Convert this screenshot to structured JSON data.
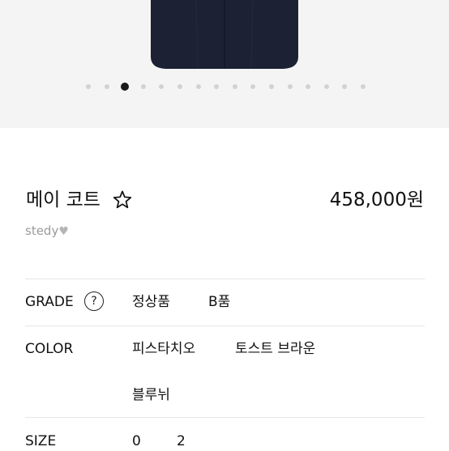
{
  "gallery": {
    "image_alt": "navy coat",
    "slide_count": 16,
    "active_slide_index": 2,
    "colors": {
      "background": "#f4f4f4",
      "coat": "#1c2233",
      "dot": "#d2d2d2",
      "dot_active": "#1a1a1a"
    }
  },
  "product": {
    "name": "메이 코트",
    "price": "458,000원",
    "seller": "stedy",
    "favorite_icon": "star-outline-icon",
    "seller_badge_icon": "heart-icon"
  },
  "options": {
    "grade": {
      "label": "GRADE",
      "help_icon": "?",
      "values": [
        "정상품",
        "B품"
      ]
    },
    "color": {
      "label": "COLOR",
      "values": [
        "피스타치오",
        "토스트 브라운",
        "블루뉘"
      ]
    },
    "size": {
      "label": "SIZE",
      "values": [
        "0",
        "2"
      ]
    }
  }
}
